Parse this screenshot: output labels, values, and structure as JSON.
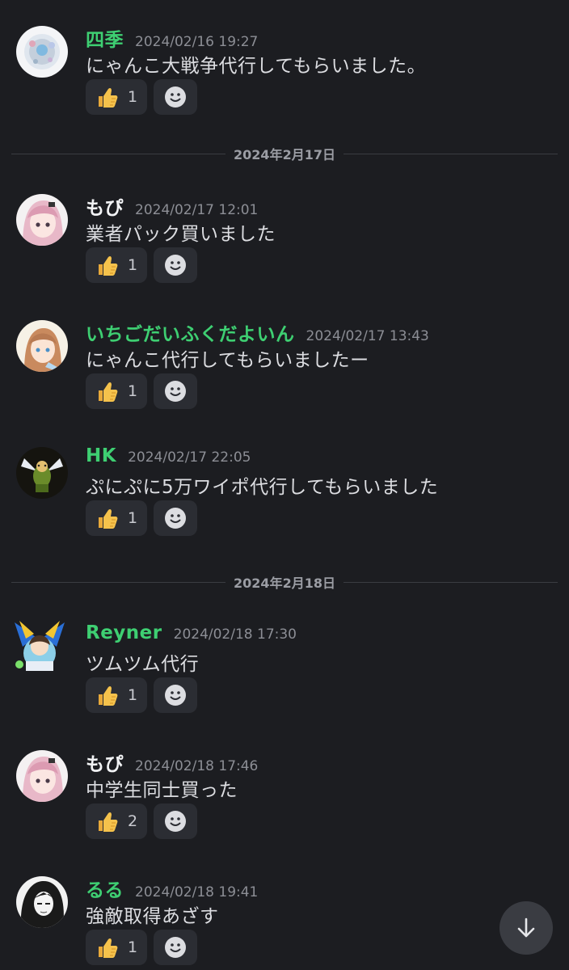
{
  "colors": {
    "background": "#1c1d21",
    "green_name": "#3ecf72",
    "white_name": "#f2f3f5",
    "timestamp": "#8c8e95",
    "reaction_bg": "#2b2d33"
  },
  "dividers": [
    {
      "label": "2024年2月17日"
    },
    {
      "label": "2024年2月18日"
    }
  ],
  "messages": [
    {
      "username": "四季",
      "timestamp": "2024/02/16 19:27",
      "text": "にゃんこ大戦争代行してもらいました。",
      "reaction_count": "1",
      "name_color": "green"
    },
    {
      "username": "もぴ",
      "timestamp": "2024/02/17 12:01",
      "text": "業者パック買いました",
      "reaction_count": "1",
      "name_color": "white"
    },
    {
      "username": "いちごだいふくだよいん",
      "timestamp": "2024/02/17 13:43",
      "text": "にゃんこ代行してもらいましたー",
      "reaction_count": "1",
      "name_color": "green"
    },
    {
      "username": "HK",
      "timestamp": "2024/02/17 22:05",
      "text": "ぷにぷに5万ワイポ代行してもらいました",
      "reaction_count": "1",
      "name_color": "green"
    },
    {
      "username": "Reyner",
      "timestamp": "2024/02/18 17:30",
      "text": "ツムツム代行",
      "reaction_count": "1",
      "name_color": "green"
    },
    {
      "username": "もぴ",
      "timestamp": "2024/02/18 17:46",
      "text": "中学生同士買った",
      "reaction_count": "2",
      "name_color": "white"
    },
    {
      "username": "るる",
      "timestamp": "2024/02/18 19:41",
      "text": "強敵取得あざす",
      "reaction_count": "1",
      "name_color": "green"
    }
  ],
  "icons": {
    "reaction_emoji": "thumbs-up-icon",
    "add_reaction": "add-reaction-icon",
    "scroll": "arrow-down-icon"
  }
}
